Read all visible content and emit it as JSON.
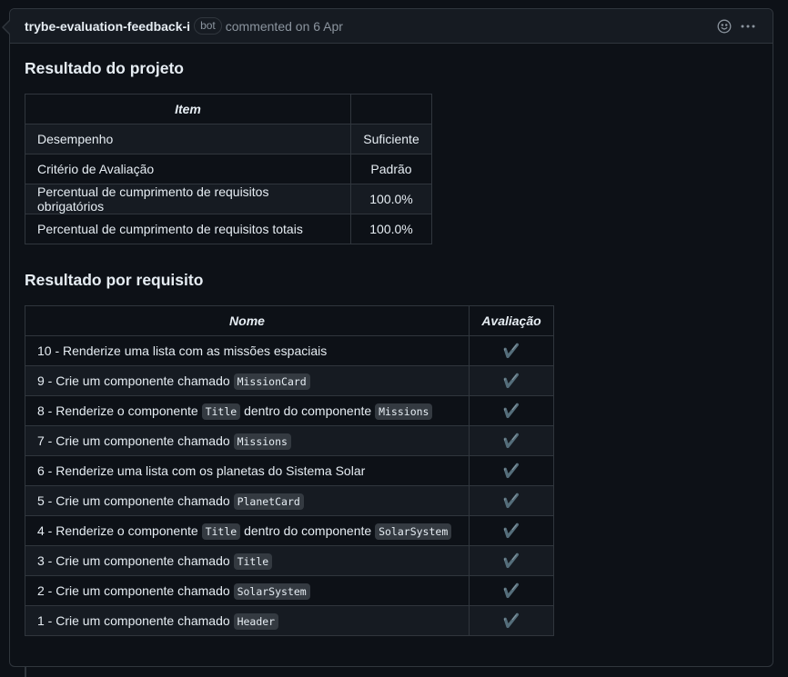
{
  "comment": {
    "author": "trybe-evaluation-feedback-i",
    "badge": "bot",
    "meta": "commented on 6 Apr",
    "icons": [
      "smiley-icon",
      "kebab-horizontal-icon"
    ]
  },
  "project": {
    "heading": "Resultado do projeto",
    "columns": [
      "Item",
      ""
    ],
    "rows": [
      {
        "item": "Desempenho",
        "value": "Suficiente"
      },
      {
        "item": "Critério de Avaliação",
        "value": "Padrão"
      },
      {
        "item": "Percentual de cumprimento de requisitos obrigatórios",
        "value": "100.0%"
      },
      {
        "item": "Percentual de cumprimento de requisitos totais",
        "value": "100.0%"
      }
    ]
  },
  "requirements": {
    "heading": "Resultado por requisito",
    "columns": [
      "Nome",
      "Avaliação"
    ],
    "check": "✔️",
    "rows": [
      {
        "parts": [
          {
            "t": "10 - Renderize uma lista com as missões espaciais"
          }
        ]
      },
      {
        "parts": [
          {
            "t": "9 - Crie um componente chamado "
          },
          {
            "c": "MissionCard"
          }
        ]
      },
      {
        "parts": [
          {
            "t": "8 - Renderize o componente "
          },
          {
            "c": "Title"
          },
          {
            "t": " dentro do componente "
          },
          {
            "c": "Missions"
          }
        ]
      },
      {
        "parts": [
          {
            "t": "7 - Crie um componente chamado "
          },
          {
            "c": "Missions"
          }
        ]
      },
      {
        "parts": [
          {
            "t": "6 - Renderize uma lista com os planetas do Sistema Solar"
          }
        ]
      },
      {
        "parts": [
          {
            "t": "5 - Crie um componente chamado "
          },
          {
            "c": "PlanetCard"
          }
        ]
      },
      {
        "parts": [
          {
            "t": "4 - Renderize o componente "
          },
          {
            "c": "Title"
          },
          {
            "t": " dentro do componente "
          },
          {
            "c": "SolarSystem"
          }
        ]
      },
      {
        "parts": [
          {
            "t": "3 - Crie um componente chamado "
          },
          {
            "c": "Title"
          }
        ]
      },
      {
        "parts": [
          {
            "t": "2 - Crie um componente chamado "
          },
          {
            "c": "SolarSystem"
          }
        ]
      },
      {
        "parts": [
          {
            "t": "1 - Crie um componente chamado "
          },
          {
            "c": "Header"
          }
        ]
      }
    ]
  }
}
